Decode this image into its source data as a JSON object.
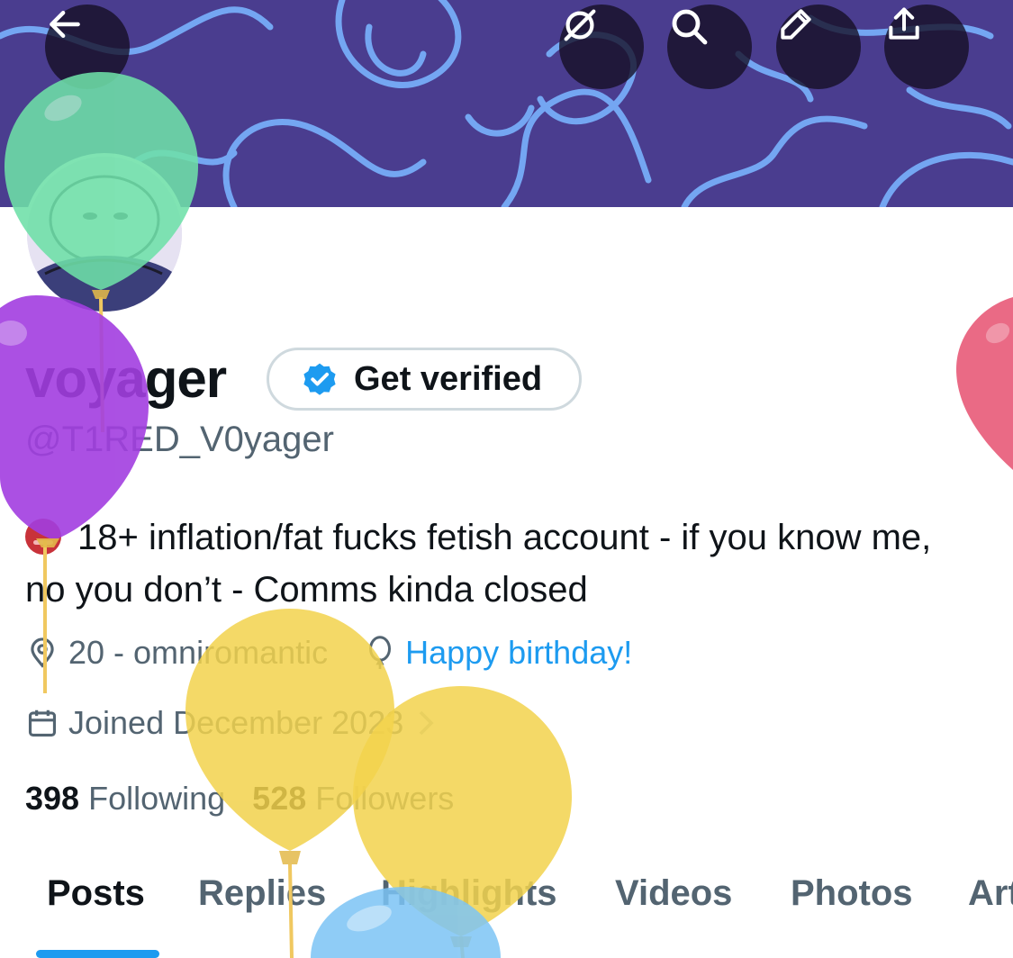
{
  "header": {
    "back_icon": "arrow-left-icon",
    "actions": [
      "no-notifications-icon",
      "search-icon",
      "edit-icon",
      "share-icon"
    ]
  },
  "profile": {
    "display_name": "voyager",
    "get_verified_label": "Get verified",
    "handle": "@T1RED_V0yager",
    "bio": "18+ inflation/fat fucks fetish account - if you know me, no you don’t - Comms kinda closed",
    "location": "20 - omniromantic",
    "birthday": "Happy birthday!",
    "joined": "Joined December 2023",
    "following_count": "398",
    "following_label": "Following",
    "followers_count": "528",
    "followers_label": "Followers"
  },
  "tabs": [
    "Posts",
    "Replies",
    "Highlights",
    "Videos",
    "Photos",
    "Art"
  ],
  "active_tab": "Posts",
  "colors": {
    "accent": "#1d9bf0",
    "banner": "#4a3d8f",
    "balloon_green": "#6ee0a8",
    "balloon_purple": "#a23ee0",
    "balloon_yellow": "#f2d24c",
    "balloon_red": "#e85a78",
    "balloon_blue": "#7cc4f5"
  }
}
